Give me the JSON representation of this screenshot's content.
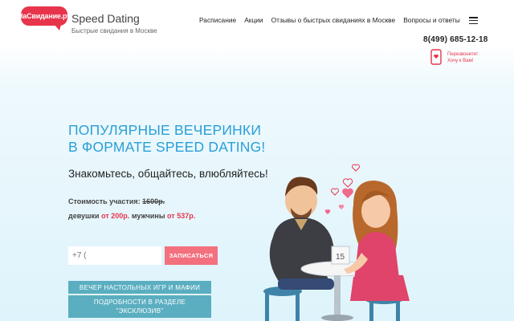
{
  "header": {
    "logo_text": "НаСвидание.ру",
    "brand_title": "Speed Dating",
    "brand_subtitle": "Быстрые свидания в Москве",
    "nav": [
      "Расписание",
      "Акции",
      "Отзывы о быстрых свиданиях в Москве",
      "Вопросы и ответы"
    ],
    "phone": "8(499) 685-12-18",
    "callback_line1": "Перезвоните!",
    "callback_line2": "Хочу к Вам!"
  },
  "hero": {
    "title_line1": "ПОПУЛЯРНЫЕ ВЕЧЕРИНКИ",
    "title_line2": "В ФОРМАТЕ SPEED DATING!",
    "subtitle": "Знакомьтесь, общайтесь, влюбляйтесь!",
    "price_label": "Стоимость участия:",
    "price_old": "1600р.",
    "women_label": "девушки",
    "women_price": "от 200р.",
    "men_label": "мужчины",
    "men_price": "от 537р.",
    "phone_placeholder": "+7 (",
    "signup_label": "ЗАПИСАТЬСЯ",
    "tag1": "ВЕЧЕР НАСТОЛЬНЫХ ИГР И МАФИИ",
    "tag2": "ПОДРОБНОСТИ В РАЗДЕЛЕ \"ЭКСКЛЮЗИВ\"",
    "table_number": "15"
  },
  "colors": {
    "brand_red": "#e8344b",
    "hero_blue": "#2a9fd8",
    "teal_button": "#5aaec0",
    "pink_button": "#f3707e"
  }
}
